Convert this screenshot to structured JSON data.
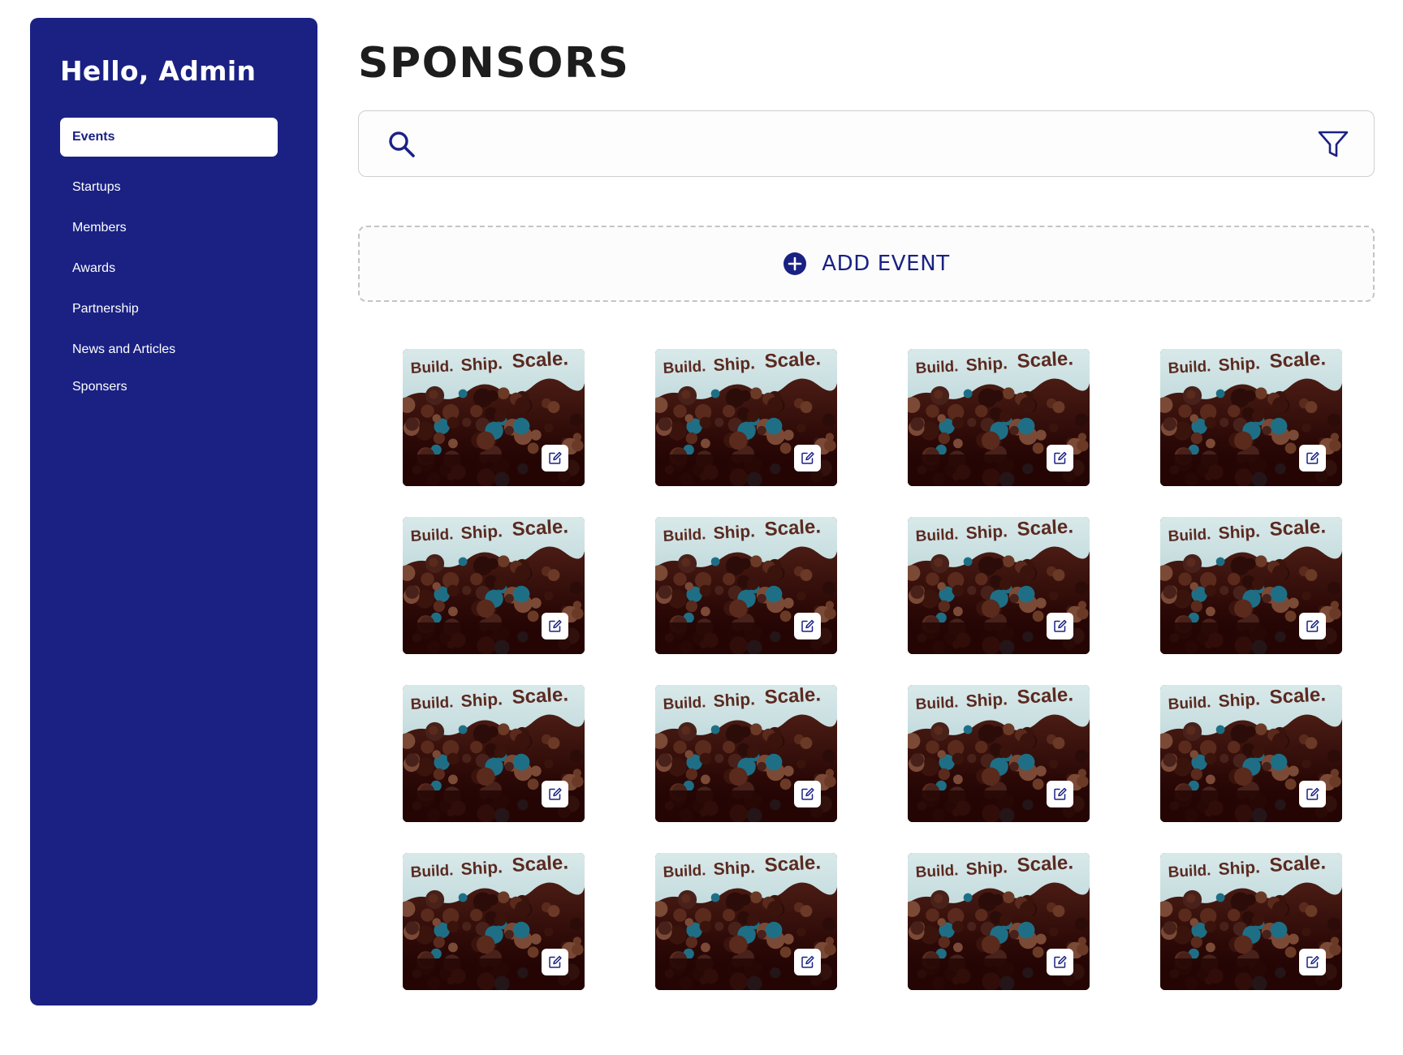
{
  "sidebar": {
    "greeting": "Hello, Admin",
    "items": [
      {
        "label": "Events",
        "active": true
      },
      {
        "label": "Startups",
        "active": false
      },
      {
        "label": "Members",
        "active": false
      },
      {
        "label": "Awards",
        "active": false
      },
      {
        "label": "Partnership",
        "active": false
      },
      {
        "label": "News and Articles",
        "active": false
      },
      {
        "label": "Sponsers",
        "active": false
      }
    ]
  },
  "main": {
    "title": "SPONSORS",
    "search": {
      "value": "",
      "placeholder": "",
      "icon": "search-icon"
    },
    "filter_icon": "filter-icon",
    "add_event": {
      "label": "ADD EVENT",
      "icon": "plus-circle-icon"
    },
    "cards": [
      {
        "row": 1,
        "col": 1,
        "image_text": [
          "Build.",
          "Ship.",
          "Scale."
        ]
      },
      {
        "row": 1,
        "col": 2,
        "image_text": [
          "Build.",
          "Ship.",
          "Scale."
        ]
      },
      {
        "row": 1,
        "col": 3,
        "image_text": [
          "Build.",
          "Ship.",
          "Scale."
        ]
      },
      {
        "row": 1,
        "col": 4,
        "image_text": [
          "Build.",
          "Ship.",
          "Scale."
        ]
      },
      {
        "row": 2,
        "col": 1,
        "image_text": [
          "Build.",
          "Ship.",
          "Scale."
        ]
      },
      {
        "row": 2,
        "col": 2,
        "image_text": [
          "Build.",
          "Ship.",
          "Scale."
        ]
      },
      {
        "row": 2,
        "col": 3,
        "image_text": [
          "Build.",
          "Ship.",
          "Scale."
        ]
      },
      {
        "row": 2,
        "col": 4,
        "image_text": [
          "Build.",
          "Ship.",
          "Scale."
        ]
      },
      {
        "row": 3,
        "col": 1,
        "image_text": [
          "Build.",
          "Ship.",
          "Scale."
        ]
      },
      {
        "row": 3,
        "col": 2,
        "image_text": [
          "Build.",
          "Ship.",
          "Scale."
        ]
      },
      {
        "row": 3,
        "col": 3,
        "image_text": [
          "Build.",
          "Ship.",
          "Scale."
        ]
      },
      {
        "row": 3,
        "col": 4,
        "image_text": [
          "Build.",
          "Ship.",
          "Scale."
        ]
      },
      {
        "row": 4,
        "col": 1,
        "image_text": [
          "Build.",
          "Ship.",
          "Scale."
        ]
      },
      {
        "row": 4,
        "col": 2,
        "image_text": [
          "Build.",
          "Ship.",
          "Scale."
        ]
      },
      {
        "row": 4,
        "col": 3,
        "image_text": [
          "Build.",
          "Ship.",
          "Scale."
        ]
      },
      {
        "row": 4,
        "col": 4,
        "image_text": [
          "Build.",
          "Ship.",
          "Scale."
        ]
      }
    ]
  },
  "colors": {
    "sidebar_bg": "#1a2183",
    "accent": "#1a2183",
    "title_text": "#1d1d1d",
    "border": "#cfcfcf"
  }
}
